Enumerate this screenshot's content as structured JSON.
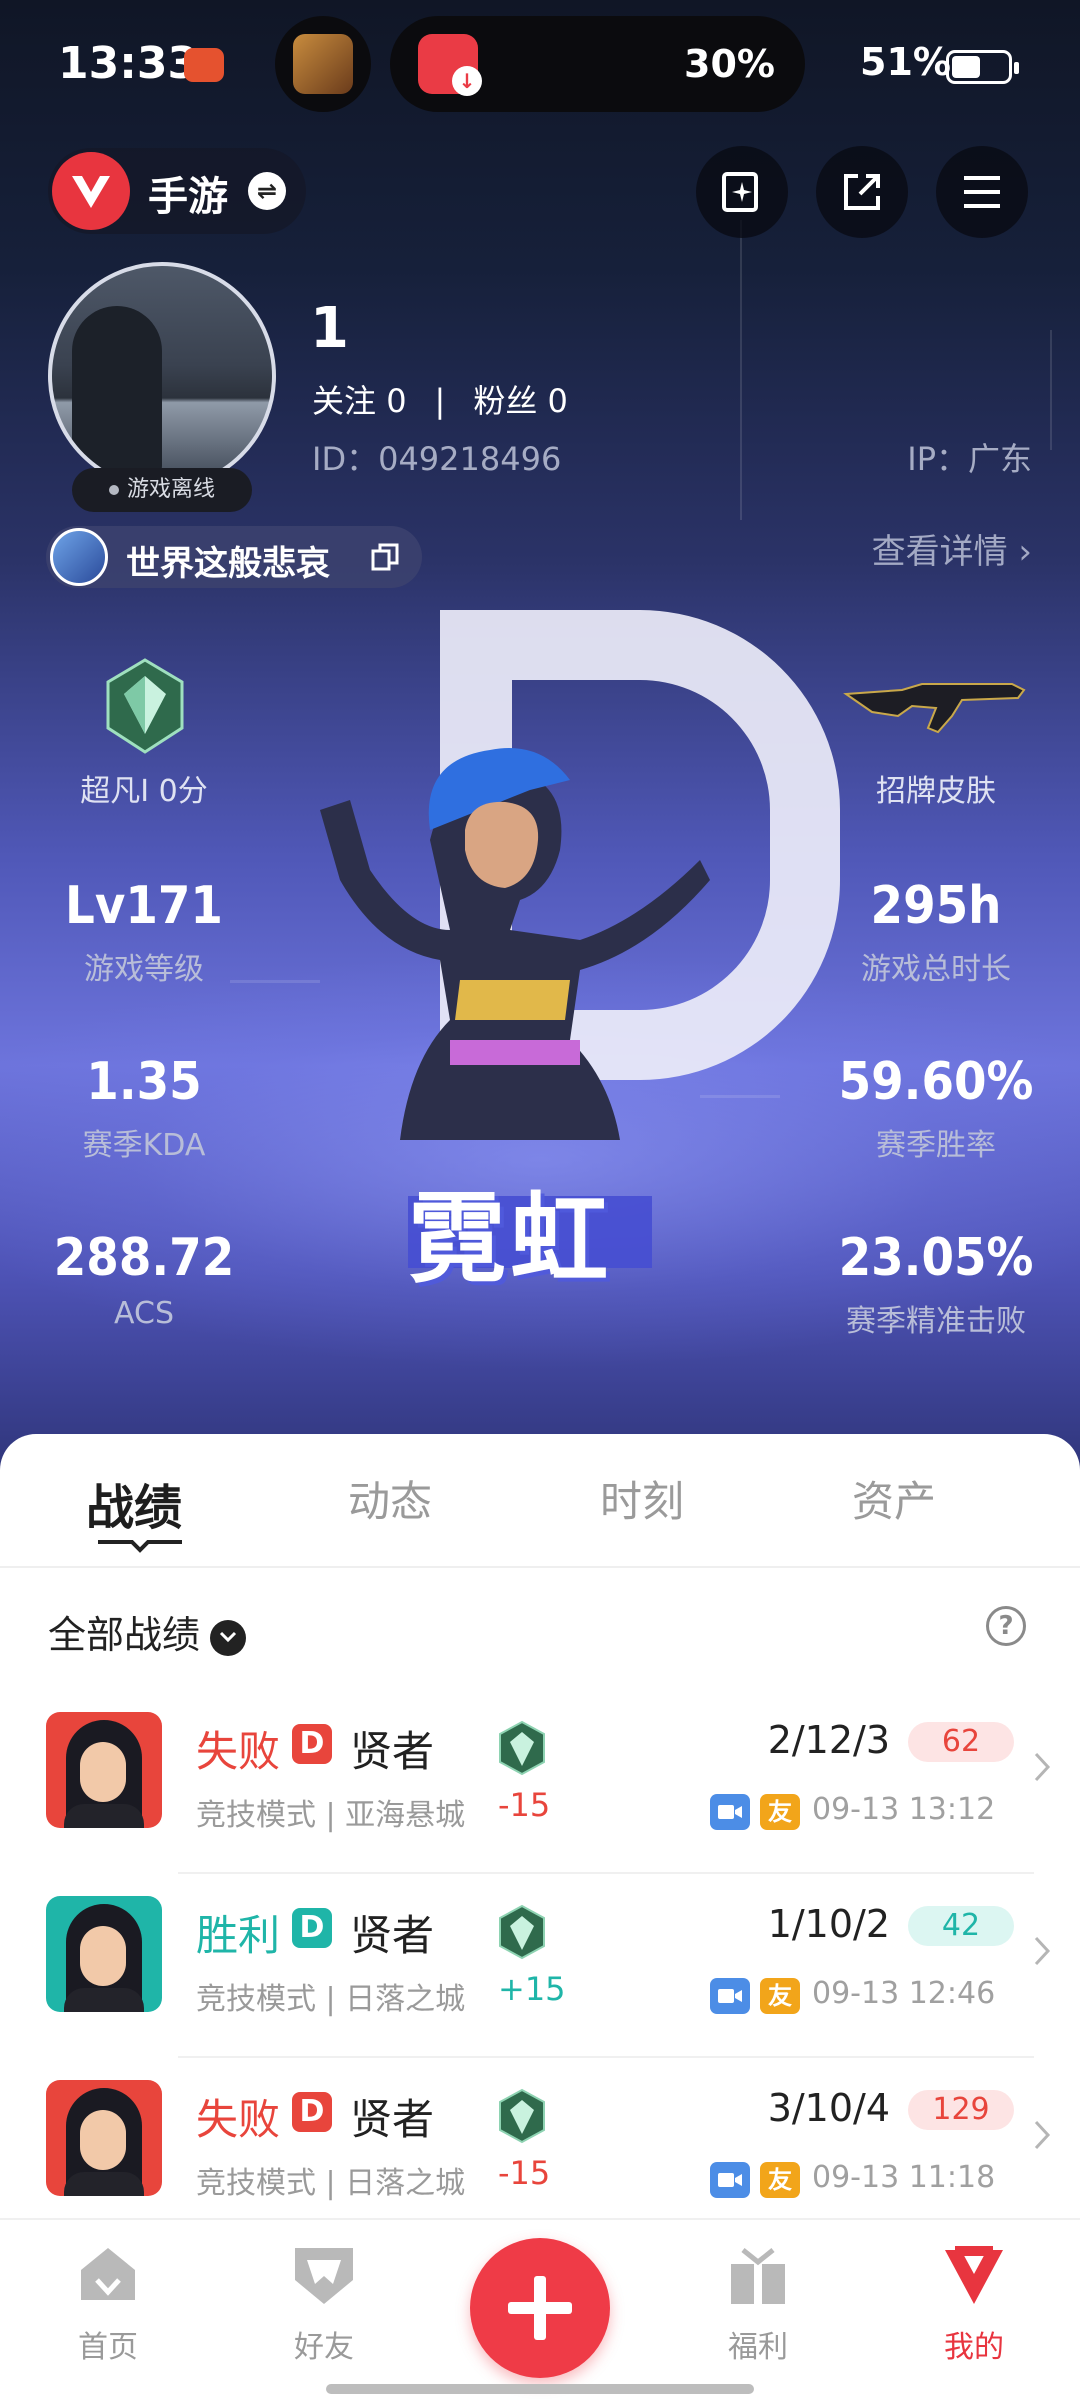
{
  "status_bar": {
    "time": "13:33",
    "download_percent": "30%",
    "battery_percent": "51%",
    "battery_level": 0.51
  },
  "top_nav": {
    "game_label": "手游"
  },
  "profile": {
    "name": "1",
    "following_label": "关注",
    "following_count": "0",
    "fans_label": "粉丝",
    "fans_count": "0",
    "separator": "|",
    "id_text": "ID：049218496",
    "ip_text": "IP：广东",
    "status": "游戏离线",
    "game_nickname": "世界这般悲哀",
    "details_link": "查看详情 ›"
  },
  "hero": {
    "agent_name": "霓虹",
    "rank_label": "超凡I 0分",
    "skin_label": "招牌皮肤"
  },
  "stats": [
    {
      "value": "Lv171",
      "label": "游戏等级"
    },
    {
      "value": "295h",
      "label": "游戏总时长"
    },
    {
      "value": "1.35",
      "label": "赛季KDA"
    },
    {
      "value": "59.60%",
      "label": "赛季胜率"
    },
    {
      "value": "288.72",
      "label": "ACS"
    },
    {
      "value": "23.05%",
      "label": "赛季精准击败"
    }
  ],
  "tabs": [
    "战绩",
    "动态",
    "时刻",
    "资产"
  ],
  "records": {
    "filter_label": "全部战绩",
    "help": "?",
    "items": [
      {
        "result": "失败",
        "badge": "D",
        "agent": "贤者",
        "mode": "竞技模式 | 亚海悬城",
        "delta": "-15",
        "kda": "2/12/3",
        "score": "62",
        "friend": "友",
        "datetime": "09-13 13:12",
        "result_color": "#e8453c",
        "score_bg": "#fde4e4",
        "score_color": "#e8453c"
      },
      {
        "result": "胜利",
        "badge": "D",
        "agent": "贤者",
        "mode": "竞技模式 | 日落之城",
        "delta": "+15",
        "kda": "1/10/2",
        "score": "42",
        "friend": "友",
        "datetime": "09-13 12:46",
        "result_color": "#1fb5a8",
        "score_bg": "#dcf6f2",
        "score_color": "#1fb5a8"
      },
      {
        "result": "失败",
        "badge": "D",
        "agent": "贤者",
        "mode": "竞技模式 | 日落之城",
        "delta": "-15",
        "kda": "3/10/4",
        "score": "129",
        "friend": "友",
        "datetime": "09-13 11:18",
        "result_color": "#e8453c",
        "score_bg": "#fde4e4",
        "score_color": "#e8453c"
      }
    ]
  },
  "bottom_nav": {
    "home": "首页",
    "friends": "好友",
    "welfare": "福利",
    "mine": "我的"
  },
  "colors": {
    "accent": "#e8353f",
    "win": "#1fb5a8",
    "loss": "#e8453c"
  }
}
